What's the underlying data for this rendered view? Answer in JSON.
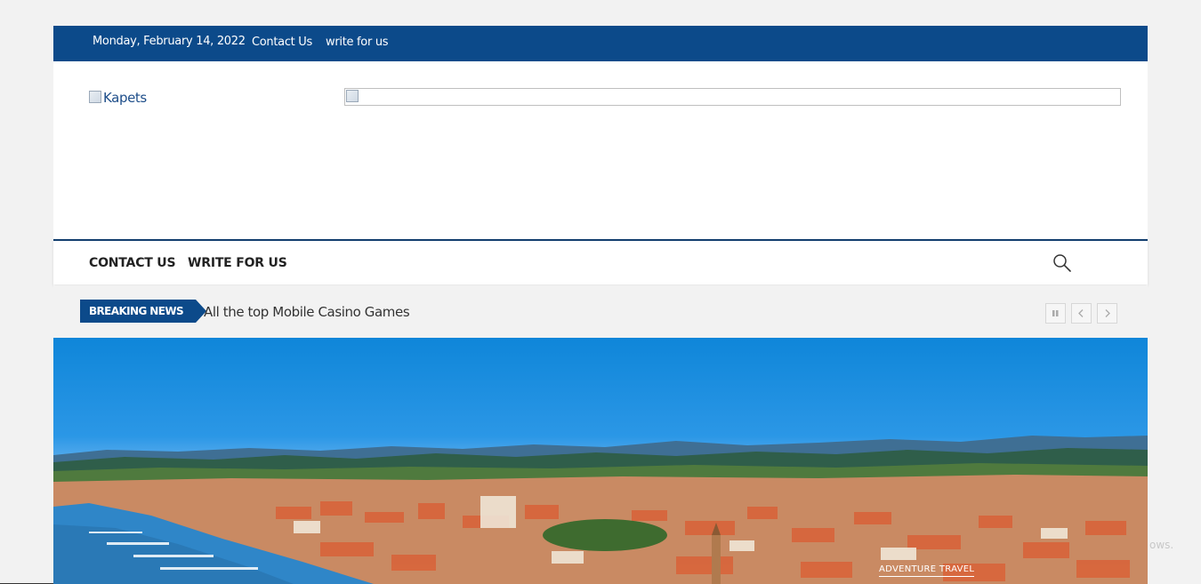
{
  "topbar": {
    "date": "Monday, February 14, 2022",
    "links": [
      "Contact Us",
      "write for us"
    ]
  },
  "header": {
    "logo_alt": "Kapets"
  },
  "nav": {
    "items": [
      "CONTACT US",
      "WRITE FOR US"
    ],
    "search_icon": "search-icon"
  },
  "breaking": {
    "label": "BREAKING NEWS",
    "headline": "All the top Mobile Casino Games",
    "controls": [
      "pause-icon",
      "chevron-left-icon",
      "chevron-right-icon"
    ]
  },
  "hero": {
    "category": "ADVENTURE TRAVEL"
  },
  "watermark": "ows.",
  "colors": {
    "brand": "#0c4a8a",
    "page_bg": "#f2f2f2"
  }
}
